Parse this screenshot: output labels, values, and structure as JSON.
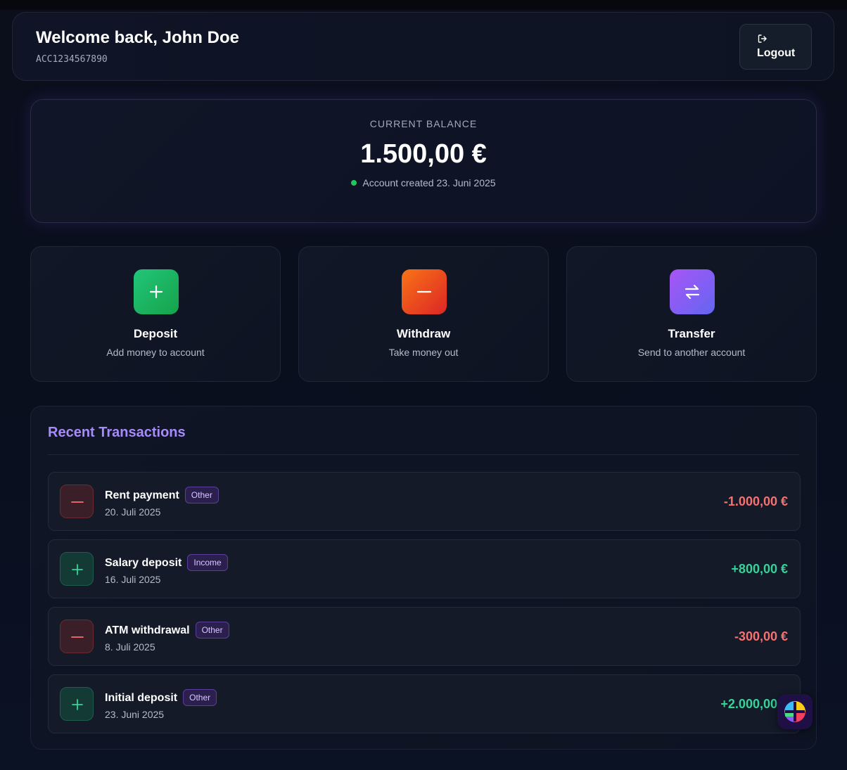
{
  "header": {
    "welcome": "Welcome back, John Doe",
    "account_number": "ACC1234567890",
    "logout_label": "Logout",
    "logout_icon": "logout-icon"
  },
  "balance": {
    "label": "CURRENT BALANCE",
    "amount": "1.500,00 €",
    "created": "Account created 23. Juni 2025",
    "status_color": "#22c55e"
  },
  "actions": [
    {
      "title": "Deposit",
      "subtitle": "Add money to account",
      "icon": "plus-icon",
      "color": "#1fb86b"
    },
    {
      "title": "Withdraw",
      "subtitle": "Take money out",
      "icon": "minus-icon",
      "color": "#f0581e"
    },
    {
      "title": "Transfer",
      "subtitle": "Send to another account",
      "icon": "arrows-swap-icon",
      "color": "#8b5cf6"
    }
  ],
  "transactions": {
    "heading": "Recent Transactions",
    "items": [
      {
        "name": "Rent payment",
        "category": "Other",
        "date": "20. Juli 2025",
        "amount": "-1.000,00 €",
        "type": "debit",
        "icon": "minus-icon"
      },
      {
        "name": "Salary deposit",
        "category": "Income",
        "date": "16. Juli 2025",
        "amount": "+800,00 €",
        "type": "credit",
        "icon": "plus-icon"
      },
      {
        "name": "ATM withdrawal",
        "category": "Other",
        "date": "8. Juli 2025",
        "amount": "-300,00 €",
        "type": "debit",
        "icon": "minus-icon"
      },
      {
        "name": "Initial deposit",
        "category": "Other",
        "date": "23. Juni 2025",
        "amount": "+2.000,00 €",
        "type": "credit",
        "icon": "plus-icon"
      }
    ]
  },
  "colors": {
    "accent": "#a78bfa",
    "debit": "#f87171",
    "credit": "#34d399"
  }
}
